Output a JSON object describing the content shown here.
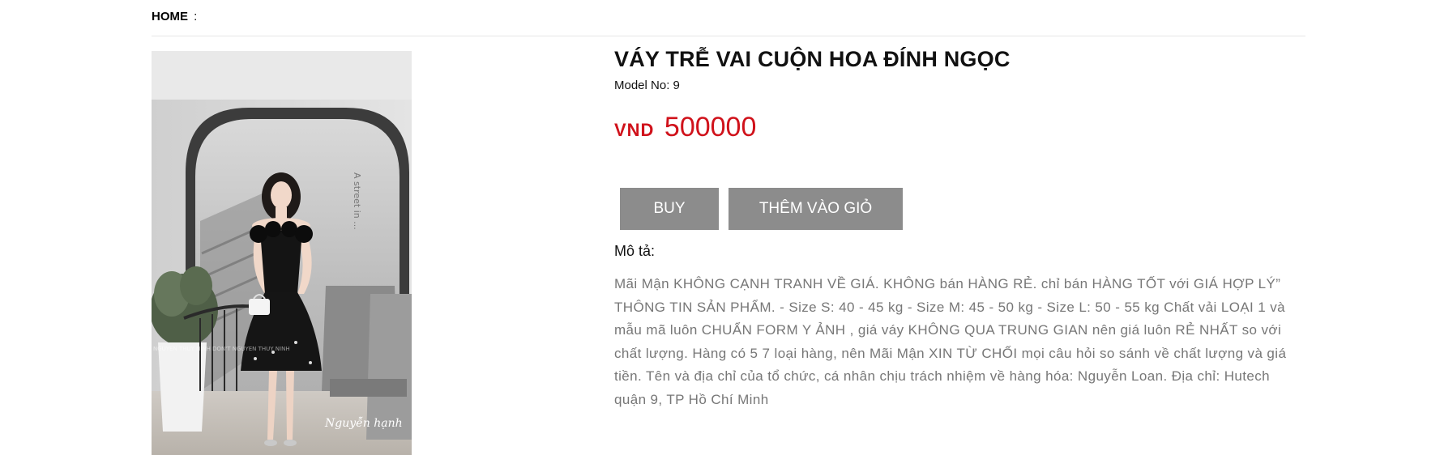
{
  "breadcrumb": {
    "home": "HOME",
    "separator": ":"
  },
  "product": {
    "title": "VÁY TRỄ VAI CUỘN HOA ĐÍNH NGỌC",
    "model_label": "Model No: 9",
    "currency": "VND",
    "price": "500000",
    "image_caption": "Nguyễn hạnh",
    "image_watermark": "NGUYEN THUY NINH DON'T NGUYEN THUY NINH",
    "image_wall_text": "A street in ...",
    "buttons": {
      "buy": "BUY",
      "add_to_cart": "THÊM VÀO GIỎ"
    },
    "description_label": "Mô tả:",
    "description": "Mãi Mận KHÔNG CẠNH TRANH VỀ GIÁ. KHÔNG bán HÀNG RẺ. chỉ bán HÀNG TỐT với GIÁ HỢP LÝ” THÔNG TIN SẢN PHẨM. - Size S: 40 - 45 kg - Size M: 45 - 50 kg - Size L: 50 - 55 kg Chất vải LOẠI 1 và mẫu mã luôn CHUẨN FORM Y ẢNH , giá váy KHÔNG QUA TRUNG GIAN nên giá luôn RẺ NHẤT so với chất lượng. Hàng có 5 7 loại hàng, nên Mãi Mận XIN TỪ CHỐI mọi câu hỏi so sánh về chất lượng và giá tiền. Tên và địa chỉ của tổ chức, cá nhân chịu trách nhiệm về hàng hóa: Nguyễn Loan. Địa chỉ: Hutech quận 9, TP Hồ Chí Minh"
  },
  "colors": {
    "price": "#d0121b",
    "button_bg": "#8c8c8c",
    "description_text": "#777777"
  }
}
